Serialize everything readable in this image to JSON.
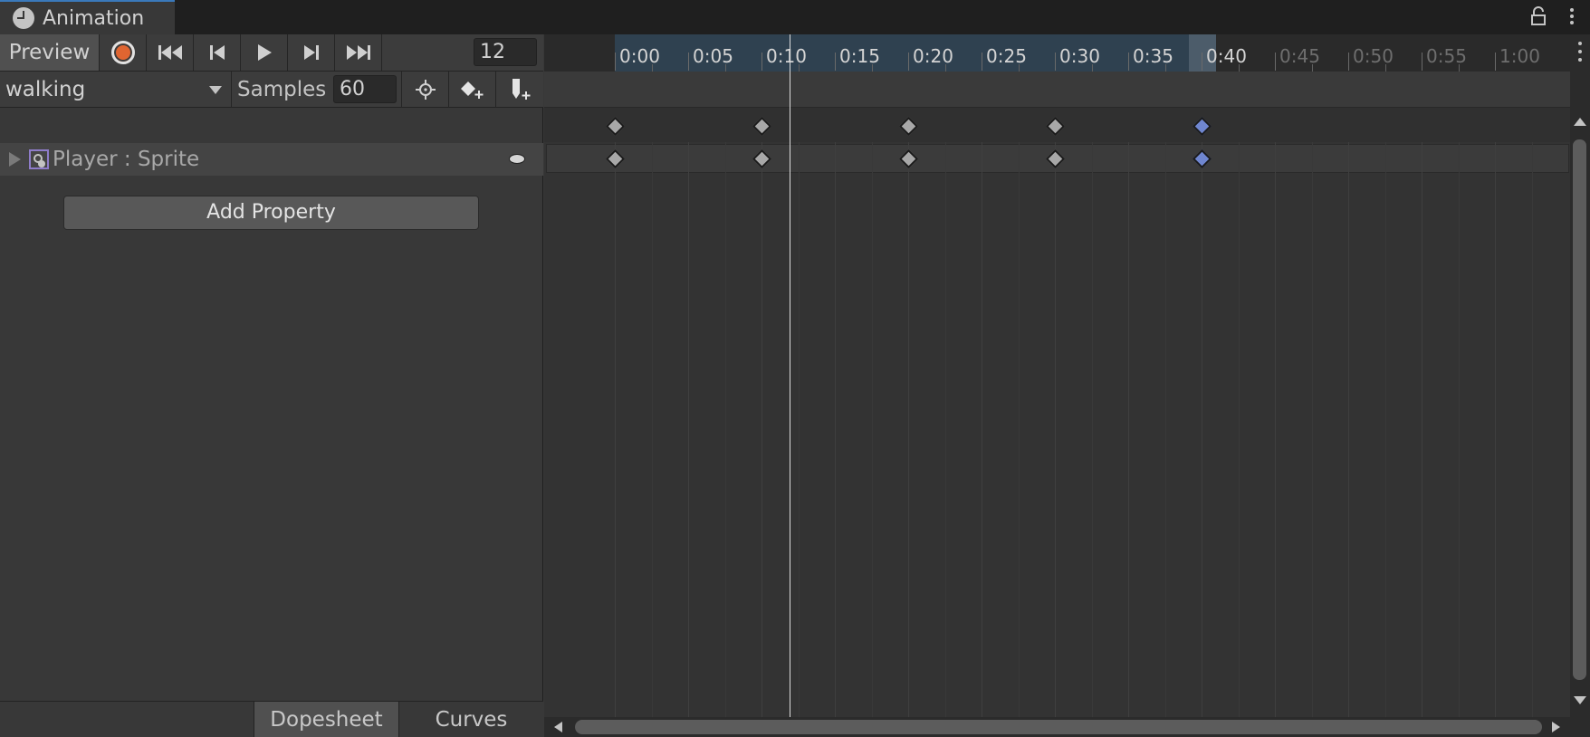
{
  "window": {
    "tab_title": "Animation",
    "icons": [
      "animation-clock-icon",
      "lock-icon",
      "kebab-menu-icon"
    ]
  },
  "toolbar": {
    "preview_label": "Preview",
    "current_frame": "12",
    "icons": [
      "record-icon",
      "first-key-icon",
      "prev-key-icon",
      "play-icon",
      "next-key-icon",
      "last-key-icon"
    ]
  },
  "clip": {
    "name": "walking",
    "samples_label": "Samples",
    "samples_value": "60",
    "icons": [
      "snap-icon",
      "add-keyframe-icon",
      "add-event-icon"
    ]
  },
  "properties": [
    {
      "label": "Player : Sprite"
    }
  ],
  "add_property_label": "Add Property",
  "bottom_tabs": {
    "dopesheet": "Dopesheet",
    "curves": "Curves"
  },
  "timeline": {
    "time_labels": [
      "0:00",
      "0:05",
      "0:10",
      "0:15",
      "0:20",
      "0:25",
      "0:30",
      "0:35",
      "0:40",
      "0:45",
      "0:50",
      "0:55",
      "1:00"
    ],
    "clip_end_label": "0:40",
    "playhead_time": "0:12",
    "keyframes": [
      {
        "time": 0,
        "selected": false
      },
      {
        "time": 10,
        "selected": false
      },
      {
        "time": 20,
        "selected": false
      },
      {
        "time": 30,
        "selected": false
      },
      {
        "time": 40,
        "selected": true
      }
    ]
  }
}
